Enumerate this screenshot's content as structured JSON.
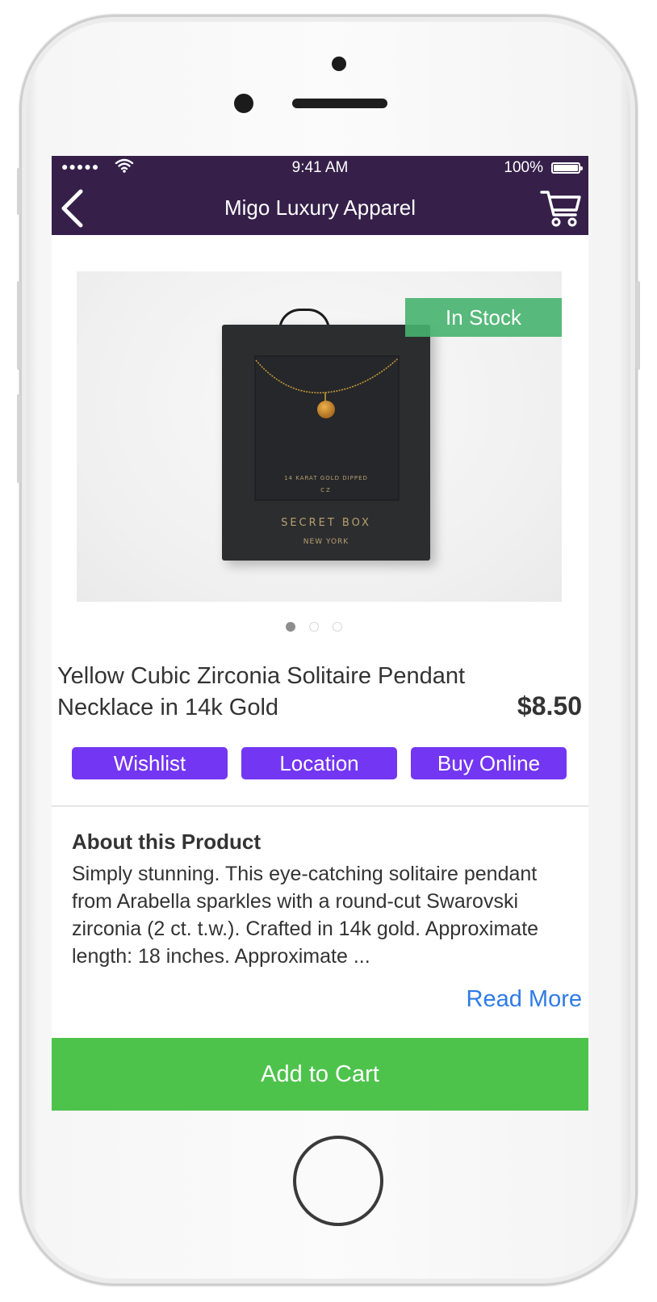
{
  "status_bar": {
    "signal_dots": "●●●●●",
    "time": "9:41 AM",
    "battery_percent": "100%"
  },
  "nav_bar": {
    "title": "Migo Luxury Apparel",
    "back_icon": "chevron-left-icon",
    "cart_icon": "cart-icon",
    "background": "#36204a"
  },
  "product": {
    "image_caption": {
      "line1": "14 KARAT GOLD DIPPED",
      "line2": "CZ",
      "brand": "SECRET BOX",
      "city": "NEW YORK"
    },
    "stock_badge": "In Stock",
    "name": "Yellow Cubic Zirconia Solitaire Pendant Necklace in 14k Gold",
    "price": "$8.50",
    "carousel": {
      "total": 3,
      "active": 1
    }
  },
  "actions": {
    "wishlist": "Wishlist",
    "location": "Location",
    "buy_online": "Buy Online",
    "color": "#7336f2"
  },
  "about": {
    "heading": "About this Product",
    "body": "Simply stunning. This eye-catching solitaire pendant from Arabella sparkles with a round-cut Swarovski zirconia (2 ct. t.w.). Crafted in 14k gold. Approximate length: 18 inches. Approximate ...",
    "read_more": "Read More",
    "read_more_color": "#2f7be5"
  },
  "footer": {
    "add_to_cart": "Add to Cart",
    "color": "#4ec34c"
  }
}
